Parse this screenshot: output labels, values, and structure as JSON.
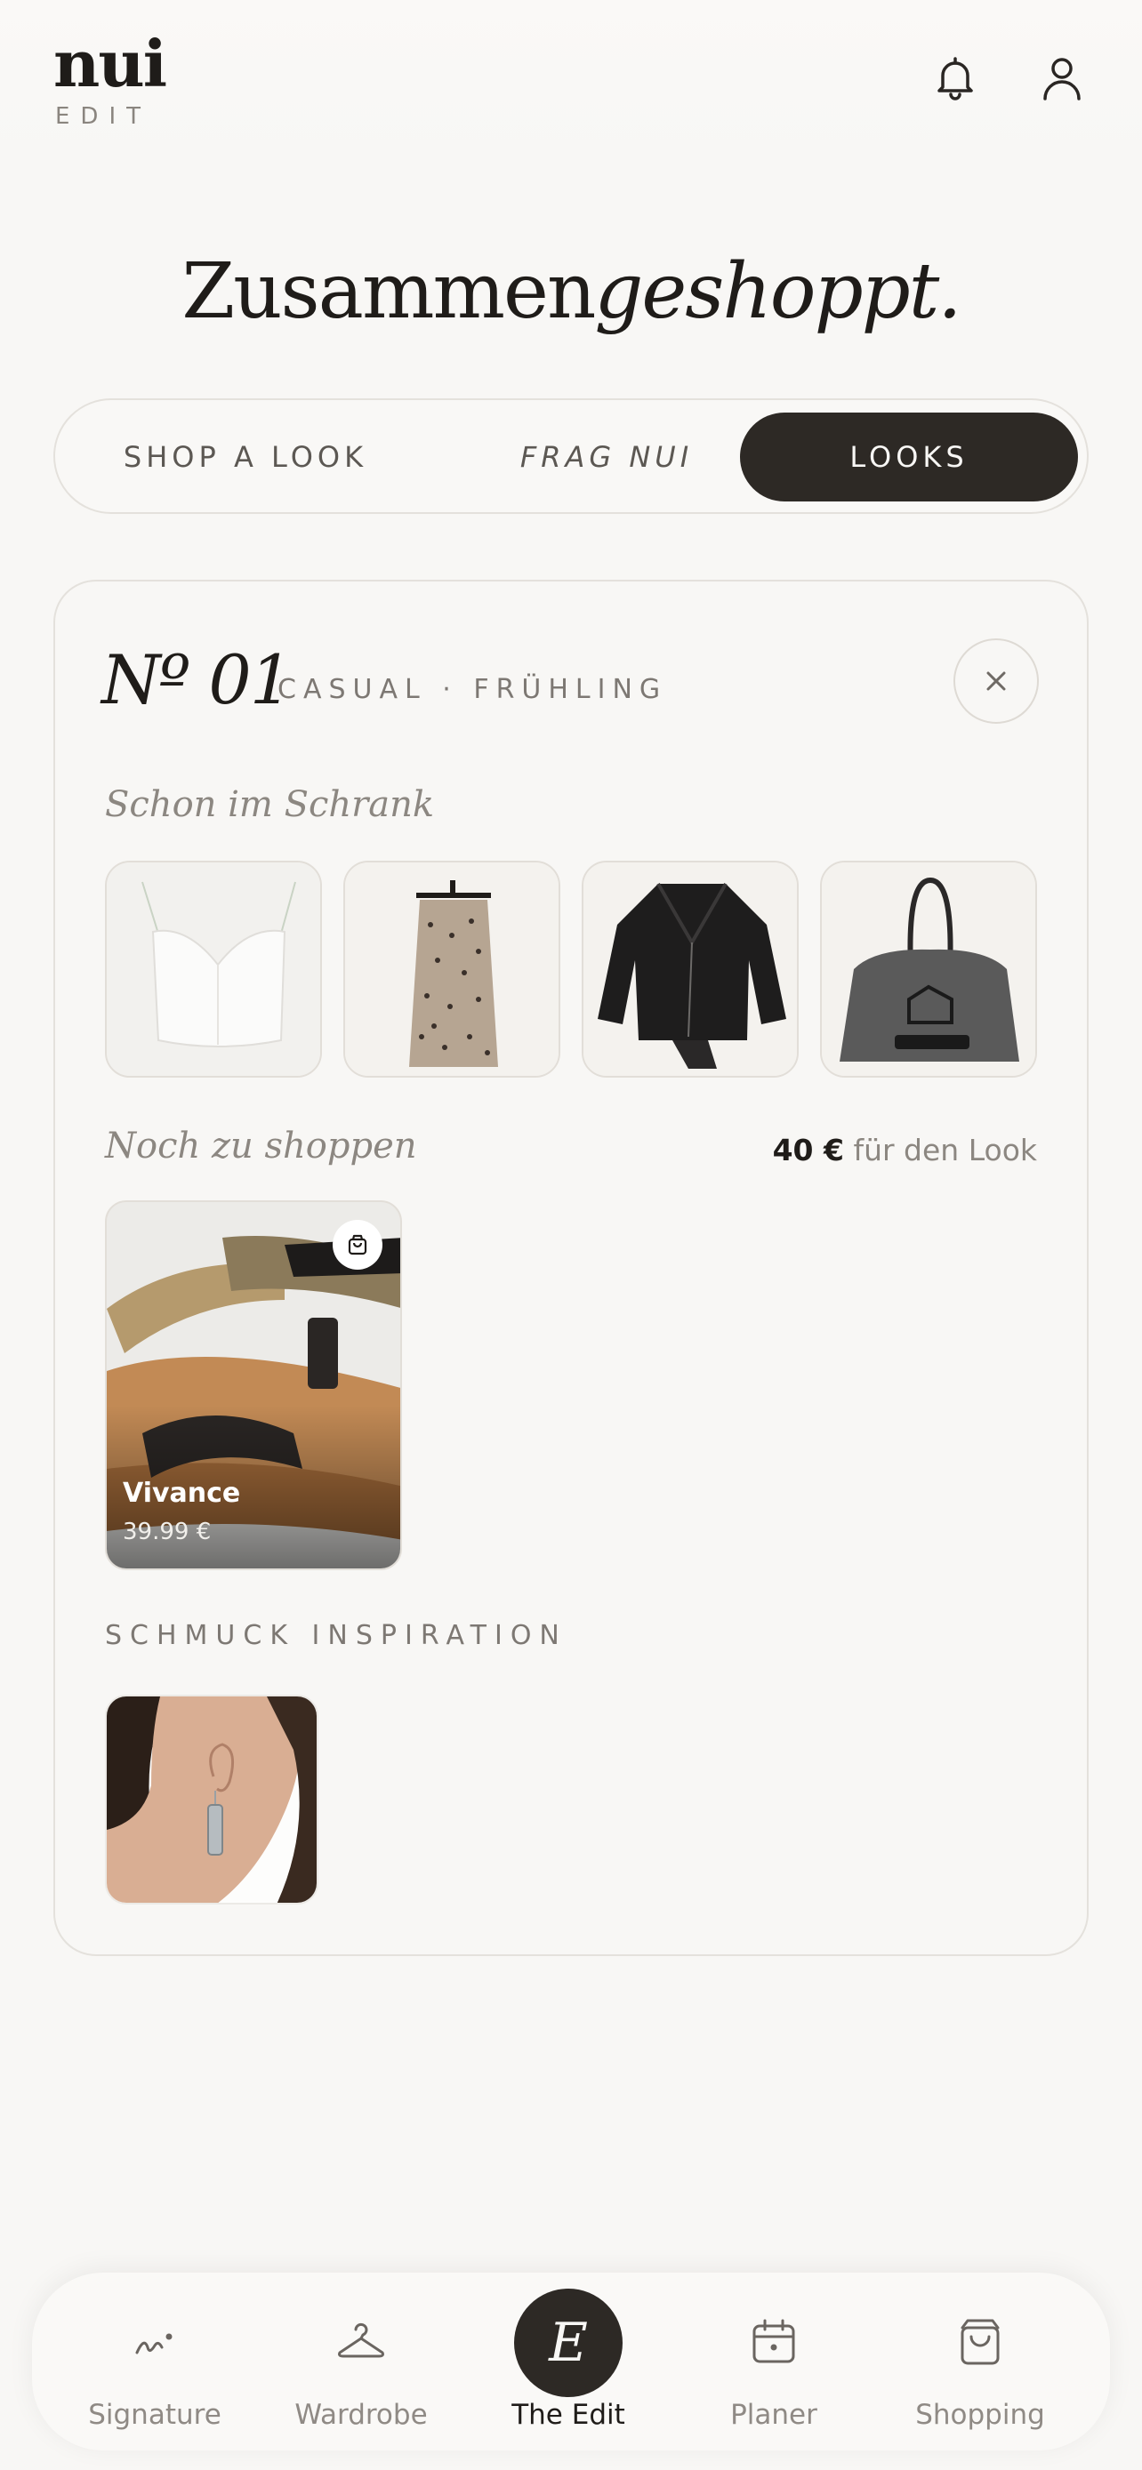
{
  "brand": {
    "name": "nui",
    "sub": "EDIT"
  },
  "header": {
    "icons": [
      "bell-icon",
      "user-icon"
    ]
  },
  "page": {
    "title_plain": "Zusammen",
    "title_italic": "geshoppt."
  },
  "segmented": {
    "shop_a_look": "SHOP A LOOK",
    "frag_nui": "FRAG NUI",
    "looks": "LOOKS",
    "active": "looks"
  },
  "look": {
    "number": "Nº 01",
    "meta": "CASUAL · FRÜHLING",
    "in_closet_heading": "Schon im Schrank",
    "in_closet_items": [
      "top",
      "skirt",
      "leather-jacket",
      "tote-bag"
    ],
    "to_shop_heading": "Noch zu shoppen",
    "total_price": "40 €",
    "total_suffix": " für den Look",
    "shop_items": [
      {
        "brand": "Vivance",
        "price": "39.99 €"
      }
    ],
    "jewelry_heading": "SCHMUCK INSPIRATION"
  },
  "nav": {
    "items": [
      {
        "label": "Signature"
      },
      {
        "label": "Wardrobe"
      },
      {
        "label": "The Edit",
        "glyph": "E"
      },
      {
        "label": "Planer"
      },
      {
        "label": "Shopping"
      }
    ],
    "active": "The Edit"
  },
  "colors": {
    "accent": "#2d2925",
    "background": "#f8f7f5",
    "border": "#e4e1dc"
  }
}
